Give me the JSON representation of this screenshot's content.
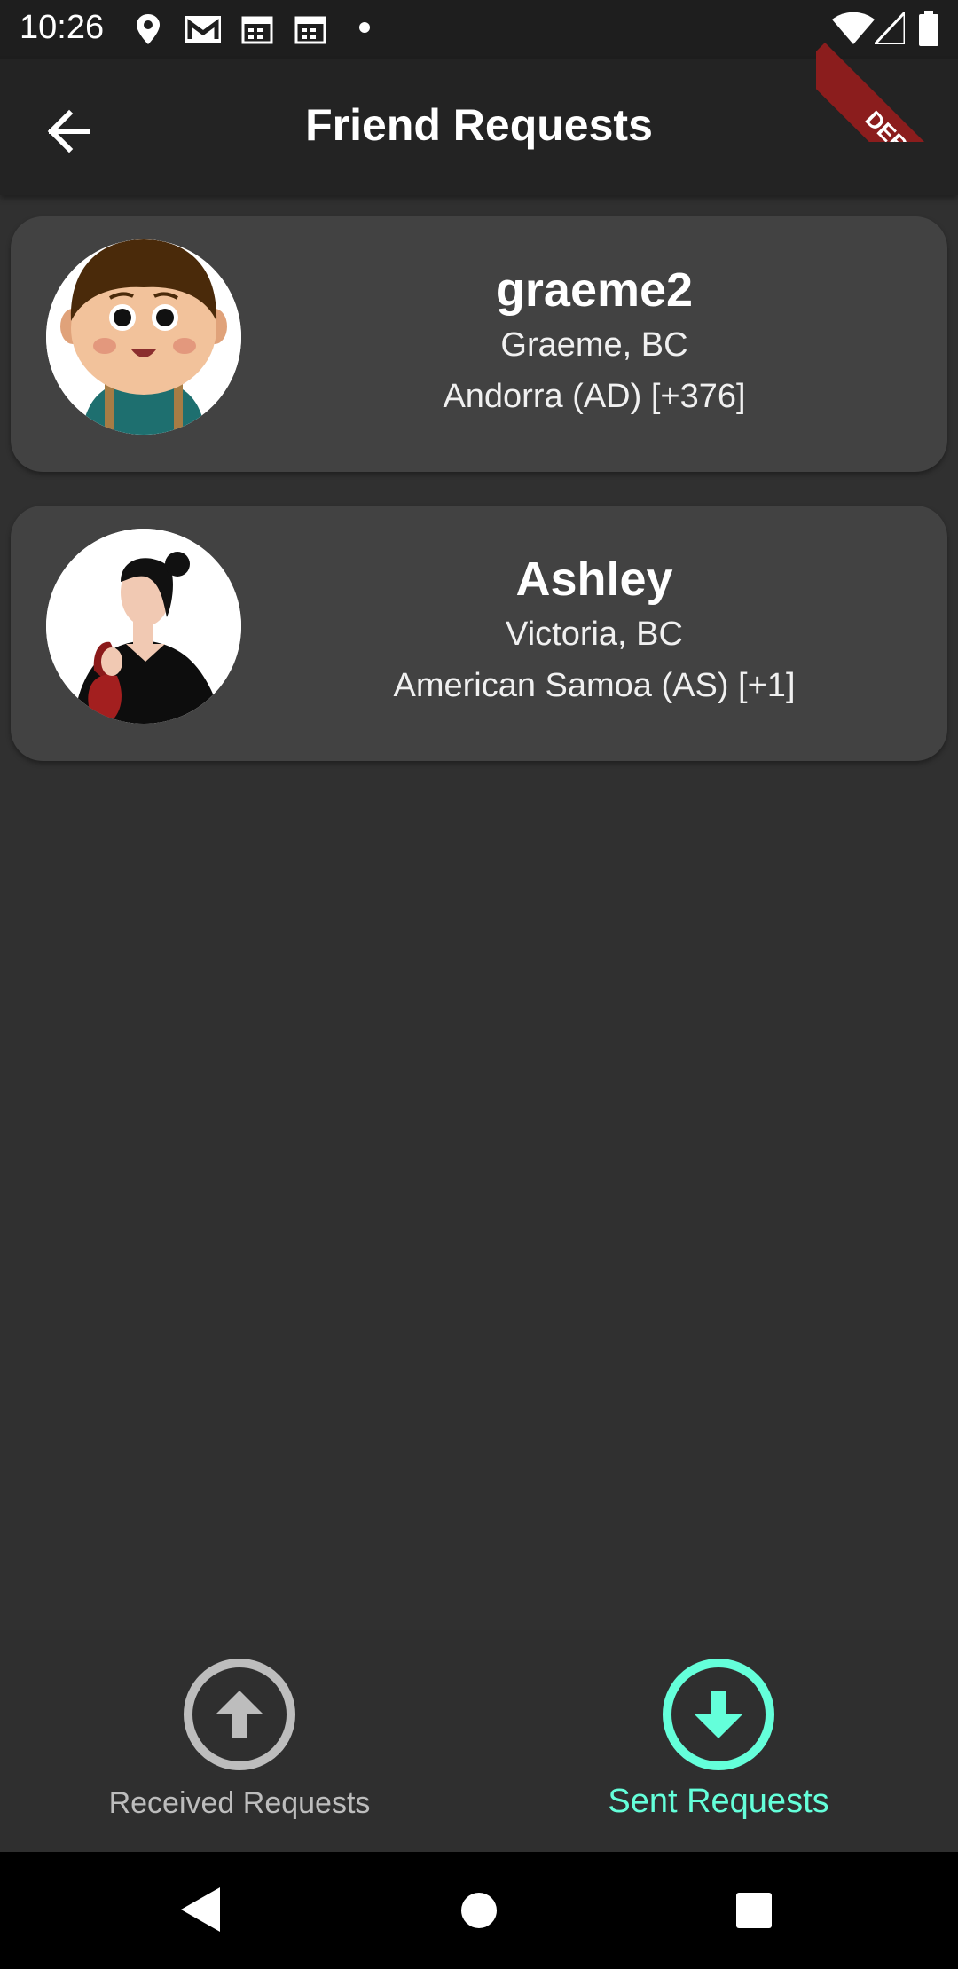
{
  "status_bar": {
    "time": "10:26",
    "icons": [
      "location-icon",
      "gmail-icon",
      "calendar-icon",
      "calendar-icon",
      "dot-icon",
      "wifi-icon",
      "signal-icon",
      "battery-icon"
    ]
  },
  "debug_banner": {
    "label": "DEBUG"
  },
  "app_bar": {
    "title": "Friend Requests",
    "back_icon": "arrow-back-icon"
  },
  "requests": [
    {
      "username": "graeme2",
      "location": "Graeme, BC",
      "country": "Andorra (AD) [+376]",
      "avatar": "cartoon-boy-avatar"
    },
    {
      "username": "Ashley",
      "location": "Victoria, BC",
      "country": "American Samoa (AS) [+1]",
      "avatar": "woman-with-bag-avatar"
    }
  ],
  "bottom_nav": {
    "items": [
      {
        "label": "Received Requests",
        "icon": "arrow-up-circle-icon",
        "active": false
      },
      {
        "label": "Sent Requests",
        "icon": "arrow-down-circle-icon",
        "active": true
      }
    ],
    "active_color": "#64ffda",
    "inactive_color": "#bdbdbd"
  },
  "system_nav": {
    "icons": [
      "back-triangle-icon",
      "home-circle-icon",
      "recents-square-icon"
    ]
  }
}
